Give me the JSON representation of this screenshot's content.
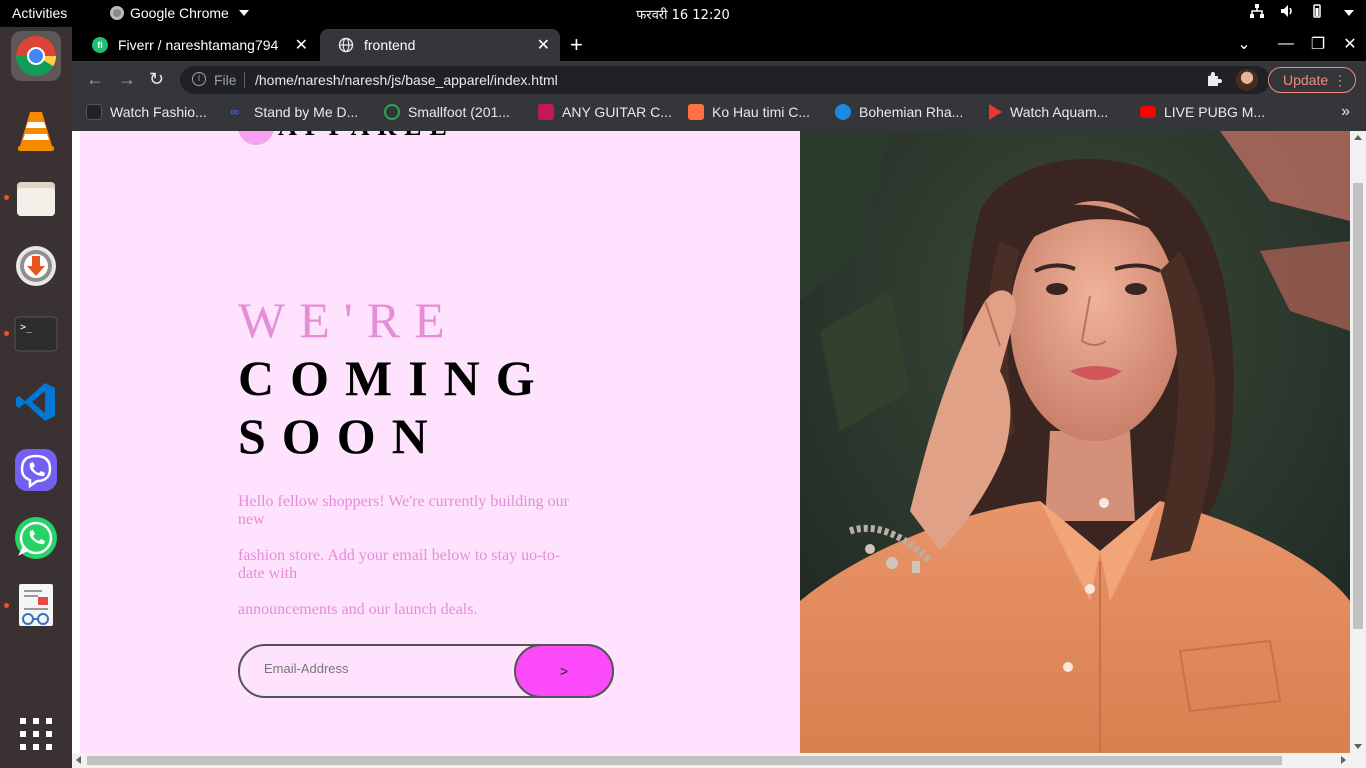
{
  "system_bar": {
    "activities": "Activities",
    "app_name": "Google Chrome",
    "clock": "फरवरी 16  12:20"
  },
  "dock": {
    "apps": [
      "Google Chrome",
      "VLC media player",
      "Files",
      "Software Updater",
      "Terminal",
      "Visual Studio Code",
      "Viber",
      "WhatsApp",
      "Document Viewer",
      "Show Applications"
    ]
  },
  "browser": {
    "tabs": [
      {
        "title": "Fiverr / nareshtamang794",
        "favicon_label": "fi",
        "favicon_color": "#1dbf73",
        "active": false
      },
      {
        "title": "frontend",
        "active": true
      }
    ],
    "omnibox": {
      "scheme": "File",
      "url": "/home/naresh/naresh/js/base_apparel/index.html"
    },
    "update_label": "Update",
    "bookmarks": [
      {
        "label": "Watch Fashio...",
        "icon_color": "#222222"
      },
      {
        "label": "Stand by Me D...",
        "icon_color": "#3a5bd9"
      },
      {
        "label": "Smallfoot (201...",
        "icon_color": "#2fa84f"
      },
      {
        "label": "ANY GUITAR C...",
        "icon_color": "#c2185b"
      },
      {
        "label": "Ko Hau timi C...",
        "icon_color": "#ff7043"
      },
      {
        "label": "Bohemian Rha...",
        "icon_color": "#1e88e5"
      },
      {
        "label": "Watch Aquam...",
        "icon_color": "#e53935"
      },
      {
        "label": "LIVE PUBG M...",
        "icon_color": "#ff0000"
      }
    ]
  },
  "page": {
    "logo_text": "APPAREL",
    "headline": {
      "line1": "WE'RE",
      "line2": "COMING",
      "line3": "SOON"
    },
    "description": [
      "Hello fellow shoppers! We're currently building our new",
      "fashion store. Add your email below to stay uo-to-date with",
      "announcements and our launch deals."
    ],
    "email_placeholder": "Email-Address",
    "submit_label": ">",
    "colors": {
      "background": "#ffe2fd",
      "accent_text": "#e48ed8",
      "button": "#fb4afa"
    }
  }
}
